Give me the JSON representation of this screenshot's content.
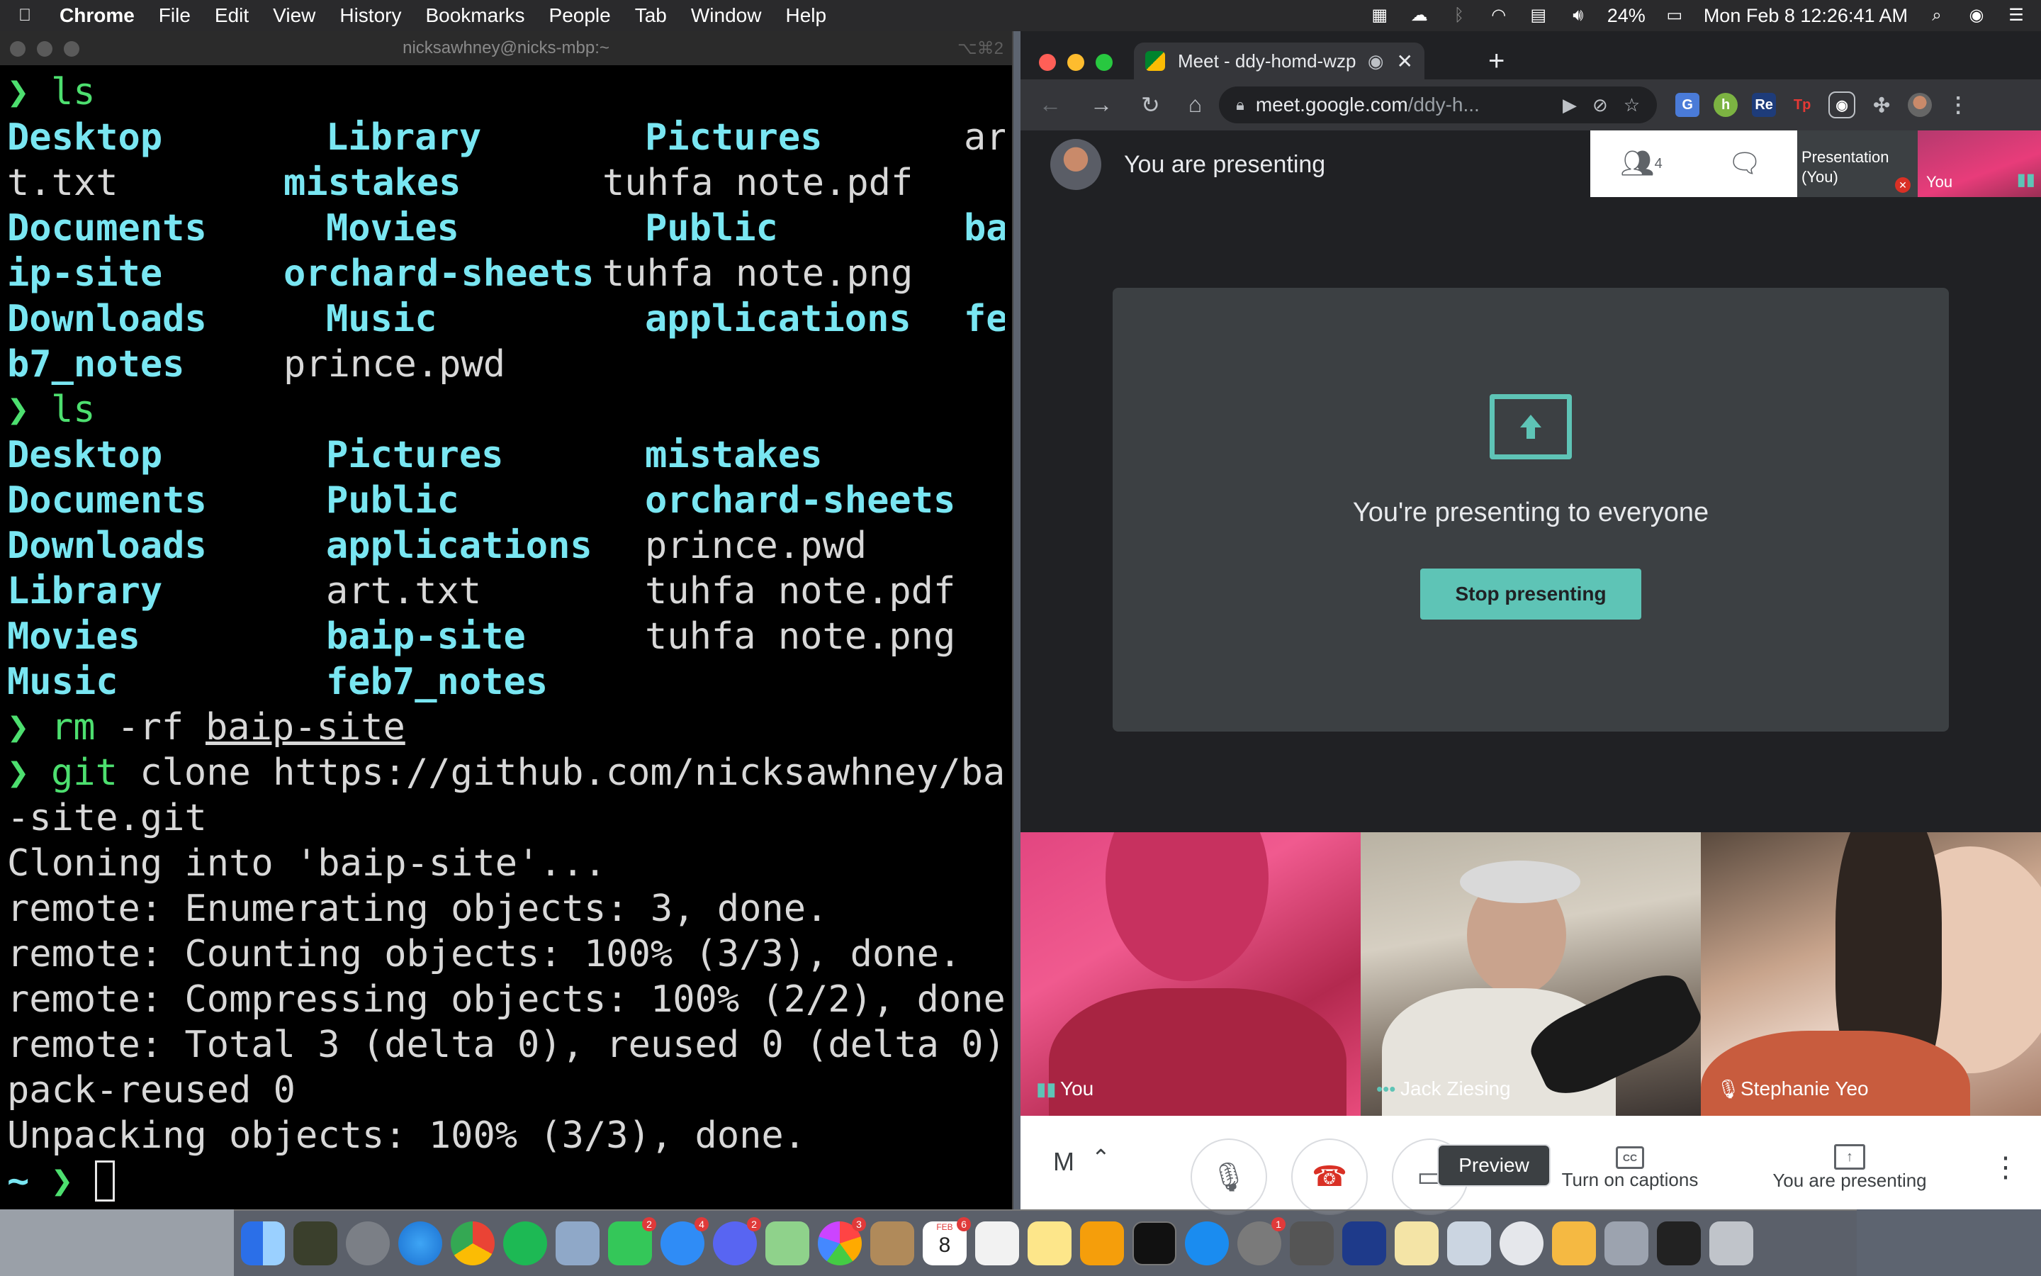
{
  "menubar": {
    "app": "Chrome",
    "menus": [
      "File",
      "Edit",
      "View",
      "History",
      "Bookmarks",
      "People",
      "Tab",
      "Window",
      "Help"
    ],
    "battery": "24%",
    "clock": "Mon Feb 8  12:26:41 AM"
  },
  "terminal": {
    "title": "nicksawhney@nicks-mbp:~",
    "shortcut": "⌥⌘2",
    "prompt_symbol": "❯",
    "home_symbol": "~",
    "ls1": [
      [
        "Desktop",
        "Library",
        "Pictures",
        "ar"
      ],
      [
        "t.txt",
        "mistakes",
        "tuhfa note.pdf",
        ""
      ],
      [
        "Documents",
        "Movies",
        "Public",
        "ba"
      ],
      [
        "ip-site",
        "orchard-sheets",
        "tuhfa note.png",
        ""
      ],
      [
        "Downloads",
        "Music",
        "applications",
        "fe"
      ],
      [
        "b7_notes",
        "prince.pwd",
        "",
        ""
      ]
    ],
    "ls2": [
      [
        "Desktop",
        "Pictures",
        "mistakes"
      ],
      [
        "Documents",
        "Public",
        "orchard-sheets"
      ],
      [
        "Downloads",
        "applications",
        "prince.pwd"
      ],
      [
        "Library",
        "art.txt",
        "tuhfa note.pdf"
      ],
      [
        "Movies",
        "baip-site",
        "tuhfa note.png"
      ],
      [
        "Music",
        "feb7_notes",
        ""
      ]
    ],
    "cmd_ls": "ls",
    "cmd_rm_prefix": "rm",
    "cmd_rm_flags": " -rf ",
    "cmd_rm_arg": "baip-site",
    "cmd_git": "git",
    "cmd_clone": " clone https://github.com/nicksawhney/baip",
    "cmd_clone_cont": "-site.git",
    "output": [
      "Cloning into 'baip-site'...",
      "remote: Enumerating objects: 3, done.",
      "remote: Counting objects: 100% (3/3), done.",
      "remote: Compressing objects: 100% (2/2), done.",
      "remote: Total 3 (delta 0), reused 0 (delta 0),",
      "pack-reused 0",
      "Unpacking objects: 100% (3/3), done."
    ]
  },
  "chrome": {
    "tab_title": "Meet - ddy-homd-wzp",
    "url_host": "meet.google.com",
    "url_path": "/ddy-h..."
  },
  "meet": {
    "header_title": "You are presenting",
    "participant_count": "4",
    "thumb_presentation": "Presentation (You)",
    "thumb_you": "You",
    "presenting_text": "You're presenting to everyone",
    "stop_button": "Stop presenting",
    "tiles": [
      {
        "name": "You"
      },
      {
        "name": "Jack Ziesing"
      },
      {
        "name": "Stephanie Yeo"
      }
    ],
    "meeting_code_initial": "M",
    "captions_label": "Turn on captions",
    "you_presenting_label": "You are presenting",
    "tooltip": "Preview"
  },
  "dock": {
    "badges": [
      "2",
      "4",
      "2",
      "3",
      "6",
      "1"
    ],
    "calendar_month": "FEB",
    "calendar_day": "8"
  }
}
